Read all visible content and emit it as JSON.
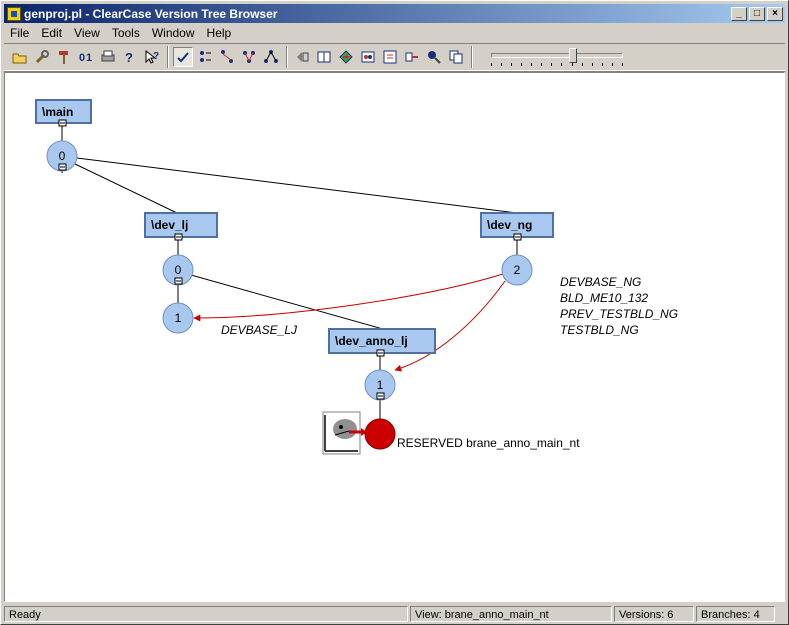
{
  "window": {
    "title": "genproj.pl - ClearCase Version Tree Browser",
    "controls": {
      "minimize": "_",
      "maximize": "□",
      "close": "×"
    }
  },
  "menu": [
    {
      "label": "File"
    },
    {
      "label": "Edit"
    },
    {
      "label": "View"
    },
    {
      "label": "Tools"
    },
    {
      "label": "Window"
    },
    {
      "label": "Help"
    }
  ],
  "toolbar": {
    "groups": [
      [
        "open-icon",
        "wrench-icon",
        "hammer-icon",
        "compare-icon",
        "print-icon",
        "help-icon",
        "context-help-icon"
      ],
      [
        "check-icon",
        "list-icon",
        "tree-icon",
        "merge-icon",
        "graph-icon"
      ],
      [
        "back-icon",
        "book-icon",
        "diamond-arrow-icon",
        "diff-icon",
        "annotate-icon",
        "link-icon",
        "pin-icon",
        "copy-icon"
      ]
    ],
    "zoom_slider_level": 0.62
  },
  "tree": {
    "branches": [
      {
        "id": "main",
        "label": "\\main"
      },
      {
        "id": "dev_lj",
        "label": "\\dev_lj"
      },
      {
        "id": "dev_ng",
        "label": "\\dev_ng"
      },
      {
        "id": "dev_anno_lj",
        "label": "\\dev_anno_lj"
      }
    ],
    "versions": [
      {
        "id": "main-0",
        "label": "0"
      },
      {
        "id": "dev_lj-0",
        "label": "0"
      },
      {
        "id": "dev_lj-1",
        "label": "1"
      },
      {
        "id": "dev_ng-2",
        "label": "2"
      },
      {
        "id": "dev_anno_lj-1",
        "label": "1"
      }
    ],
    "labels": {
      "dev_lj_1": "DEVBASE_LJ",
      "dev_ng_2": [
        "DEVBASE_NG",
        "BLD_ME10_132",
        "PREV_TESTBLD_NG",
        "TESTBLD_NG"
      ]
    },
    "checkout": {
      "text": "RESERVED brane_anno_main_nt",
      "color": "#cc0000"
    },
    "colors": {
      "node": "#a8c8f0",
      "merge_arrow": "#cc0000"
    }
  },
  "status": {
    "state": "Ready",
    "view": "View:  brane_anno_main_nt",
    "versions": "Versions:  6",
    "branches": "Branches:  4"
  }
}
